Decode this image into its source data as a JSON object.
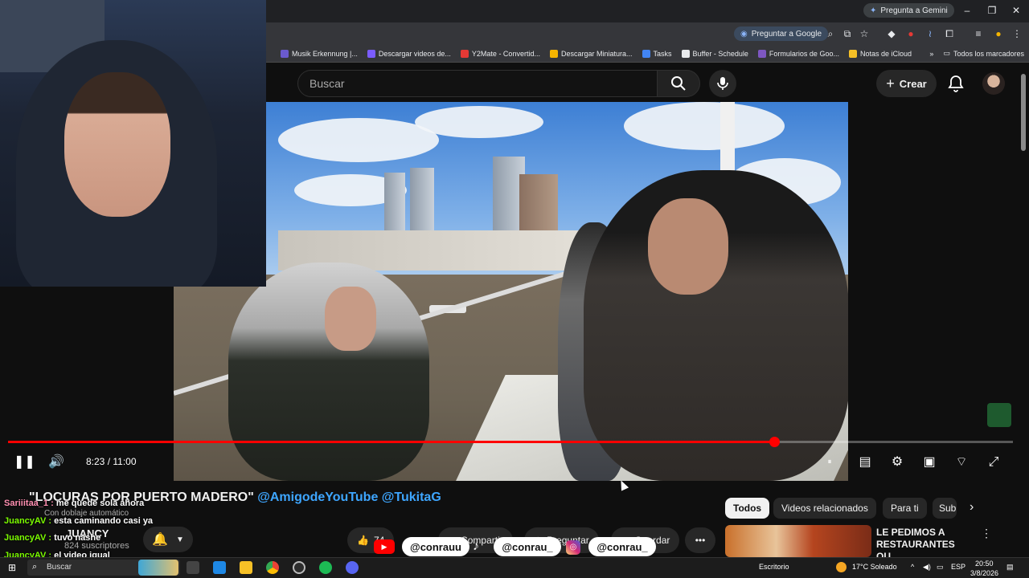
{
  "browser": {
    "gemini_label": "Pregunta a Gemini",
    "ask_google_label": "Preguntar a Google",
    "bookmarks": [
      {
        "label": "Musik Erkennung |...",
        "icon": "music-icon",
        "color": "#6a5acd"
      },
      {
        "label": "Descargar videos de...",
        "icon": "download-icon",
        "color": "#7b5cff"
      },
      {
        "label": "Y2Mate - Convertid...",
        "icon": "y2mate-icon",
        "color": "#e53935"
      },
      {
        "label": "Descargar Miniatura...",
        "icon": "image-icon",
        "color": "#f4b400"
      },
      {
        "label": "Tasks",
        "icon": "tasks-icon",
        "color": "#4285f4"
      },
      {
        "label": "Buffer - Schedule",
        "icon": "buffer-icon",
        "color": "#e8eaed"
      },
      {
        "label": "Formularios de Goo...",
        "icon": "forms-icon",
        "color": "#7e57c2"
      },
      {
        "label": "Notas de iCloud",
        "icon": "notes-icon",
        "color": "#f6c026"
      }
    ],
    "all_bookmarks_label": "Todos los marcadores"
  },
  "youtube": {
    "search_placeholder": "Buscar",
    "create_label": "Crear",
    "player": {
      "time_current": "8:23",
      "time_total": "11:00",
      "time_display": "8:23 / 11:00",
      "progress": 0.762
    },
    "video_title_quote": "\"LOCURAS POR PUERTO MADERO\"",
    "video_title_tags": "@AmigodeYouTube @TukitaG",
    "dub_label": "Con doblaje automático",
    "channel_name": "JUANCY",
    "subscribers": "824 suscriptores",
    "actions": {
      "like_count": "74",
      "share_label": "Compartir",
      "ask_label": "Preguntar",
      "save_label": "Guardar"
    },
    "filter_pills": [
      "Todos",
      "Videos relacionados",
      "Para ti",
      "Sub"
    ],
    "recommended_title": "LE PEDIMOS A RESTAURANTES QU..."
  },
  "overlay": {
    "chat": [
      {
        "user": "Sariiitaa_1 :",
        "message": "me quede sola ahora",
        "color": "#ff8fb1"
      },
      {
        "user": "JuancyAV :",
        "message": "esta caminando casi ya",
        "color": "#7CFC00"
      },
      {
        "user": "JuancyAV :",
        "message": "tuvo nashe",
        "color": "#7CFC00"
      },
      {
        "user": "JuancyAV :",
        "message": "el video igual",
        "color": "#7CFC00"
      }
    ],
    "social_handles": [
      {
        "platform": "youtube-icon",
        "handle": "@conrauu"
      },
      {
        "platform": "tiktok-icon",
        "handle": "@conrau_"
      },
      {
        "platform": "instagram-icon",
        "handle": "@conrau_"
      }
    ]
  },
  "taskbar": {
    "search_label": "Buscar",
    "desktop_label": "Escritorio",
    "weather": "17°C  Soleado",
    "language": "ESP",
    "time": "20:50",
    "date": "3/8/2026"
  }
}
